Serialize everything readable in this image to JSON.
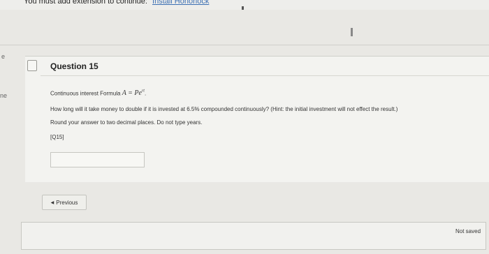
{
  "banner": {
    "text": "You must add extension to continue:",
    "link": "Install Honorlock"
  },
  "left_edge": {
    "frag1": "e",
    "frag2": "ne"
  },
  "question": {
    "title": "Question 15",
    "formula_label": "Continuous interest Formula",
    "formula": "A = Pe",
    "formula_exp": "rt",
    "prompt": "How long will it take money to double if it is invested at 6.5% compounded continuously? (Hint: the initial investment will not effect the result.)",
    "instruction": "Round your answer to two decimal places. Do not type years.",
    "tag": "[Q15]",
    "answer_value": ""
  },
  "navigation": {
    "previous_label": "Previous"
  },
  "footer": {
    "status": "Not saved"
  }
}
